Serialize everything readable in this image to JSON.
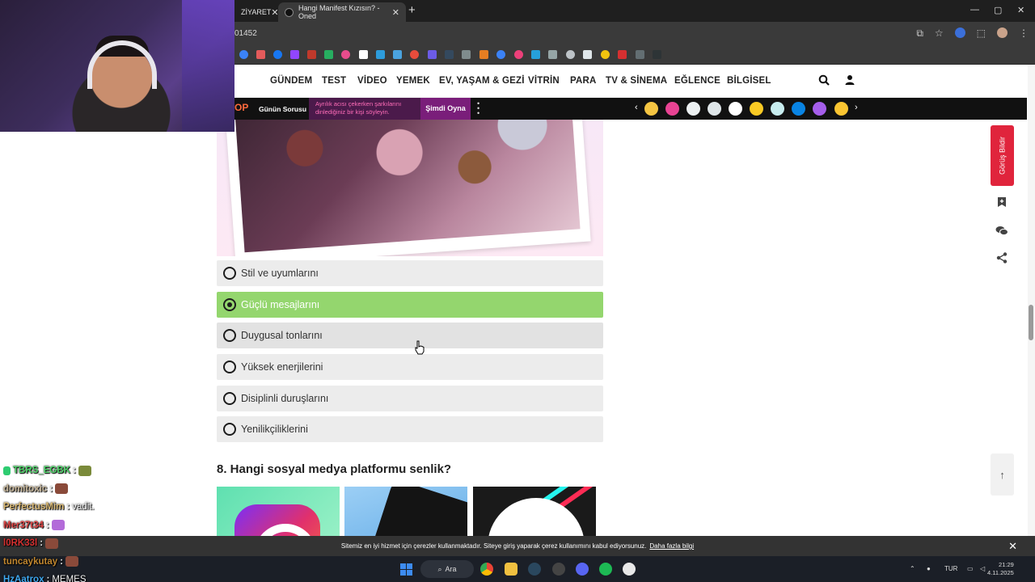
{
  "browser": {
    "tabs": [
      {
        "title": "ZİYARET",
        "active": false
      },
      {
        "title": "Hangi Manifest Kızısın? - Oned",
        "active": true
      }
    ],
    "new_tab": "+",
    "url": "01452",
    "window_controls": [
      "—",
      "▢",
      "✕"
    ]
  },
  "site_nav": {
    "items": [
      "GÜNDEM",
      "TEST",
      "VİDEO",
      "YEMEK",
      "EV, YAŞAM & GEZİ",
      "VİTRİN",
      "PARA",
      "TV & SİNEMA",
      "EĞLENCE",
      "BİLGİSEL"
    ]
  },
  "promo": {
    "logo": "OP",
    "daily_question_label": "Günün Sorusu",
    "question_text": "Ayrılık acısı çekerken şarkılarını dinlediğiniz bir kişi söyleyin.",
    "play_label": "Şimdi Oyna",
    "prev": "‹",
    "next": "›"
  },
  "quiz": {
    "options": [
      {
        "label": "Stil ve uyumlarını",
        "selected": false
      },
      {
        "label": "Güçlü mesajlarını",
        "selected": true
      },
      {
        "label": "Duygusal tonlarını",
        "selected": false
      },
      {
        "label": "Yüksek enerjilerini",
        "selected": false
      },
      {
        "label": "Disiplinli duruşlarını",
        "selected": false
      },
      {
        "label": "Yenilikçiliklerini",
        "selected": false
      }
    ],
    "next_question": "8. Hangi sosyal medya platformu senlik?"
  },
  "right_rail": {
    "report_label": "Görüş Bildir",
    "scroll_top": "↑"
  },
  "cookie": {
    "text": "Sitemiz en iyi hizmet için çerezler kullanmaktadır. Siteye giriş yaparak çerez kullanımını kabul ediyorsunuz.",
    "link": "Daha fazla bilgi",
    "close": "✕"
  },
  "taskbar": {
    "search_label": "Ara",
    "language": "TUR",
    "time": "21:29",
    "date": "4.11.2025"
  },
  "chat": [
    {
      "user": "TBRS_EGBK",
      "msg": "",
      "color": "#4fd46a"
    },
    {
      "user": "domitoxic",
      "msg": "",
      "color": "#c8b79a"
    },
    {
      "user": "PerfectusMim",
      "msg": "vadit.",
      "color": "#d9b873"
    },
    {
      "user": "Mer37t34",
      "msg": "",
      "color": "#e04646"
    },
    {
      "user": "l0RK33l",
      "msg": "",
      "color": "#d63030"
    },
    {
      "user": "tuncaykutay",
      "msg": "",
      "color": "#c0862f"
    },
    {
      "user": "HzAatrox",
      "msg": "MEMES",
      "color": "#3fa8f0"
    }
  ],
  "colors": {
    "selected_option": "#94d66e",
    "report_button": "#e0243c",
    "promo_play": "#7a1e7a"
  }
}
